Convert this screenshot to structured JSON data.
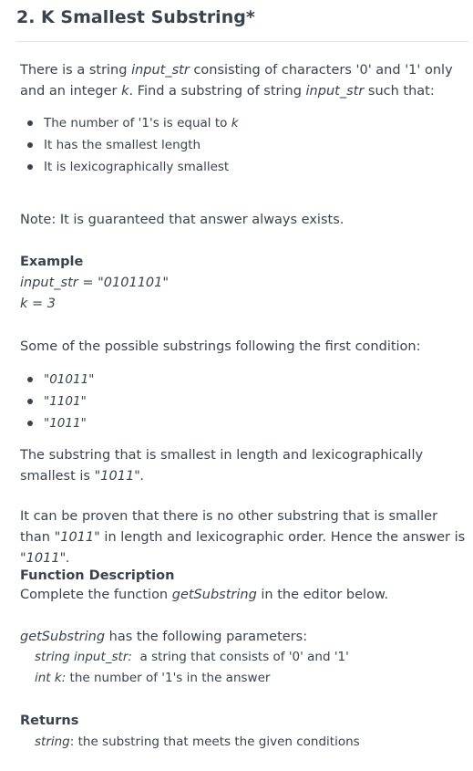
{
  "problem": {
    "title": "2. K Smallest Substring*"
  },
  "intro": {
    "part1": "There is a string ",
    "var_str": "input_str",
    "part2": " consisting of characters '0' and '1' only and an integer ",
    "var_k": "k",
    "part3": ". Find a substring of string ",
    "var_str2": "input_str",
    "part4": " such that:"
  },
  "conditions": [
    {
      "text": "The number of '1's is equal to ",
      "var": "k"
    },
    {
      "text": "It has the smallest length",
      "var": ""
    },
    {
      "text": "It is lexicographically smallest",
      "var": ""
    }
  ],
  "note": "Note: It is guaranteed that answer always exists.",
  "example": {
    "heading": "Example",
    "line1": "input_str = \"0101101\"",
    "line2": "k = 3"
  },
  "possible": {
    "text": "Some of the possible substrings following the first condition:",
    "items": [
      "\"01011\"",
      "\"1101\"",
      "\"1011\""
    ]
  },
  "smallest": {
    "part1": "The substring that is smallest in length and lexicographically smallest is ",
    "answer": "\"1011\"."
  },
  "proof": {
    "part1": "It can be proven that there is no other substring that is smaller than ",
    "answer1": "\"1011\"",
    "part2": " in length and lexicographic order. Hence the answer is ",
    "answer2": "\"1011\"."
  },
  "function_description": {
    "heading": "Function Description",
    "part1": "Complete the function ",
    "fn": "getSubstring",
    "part2": " in the editor below."
  },
  "parameters": {
    "fn": "getSubstring",
    "intro": " has the following parameters:",
    "items": [
      {
        "sig": "string input_str:",
        "desc": "  a string that consists of '0' and '1'"
      },
      {
        "sig": "int k:",
        "desc": " the number of '1's in the answer"
      }
    ]
  },
  "returns": {
    "heading": "Returns",
    "sig": "string",
    "desc": ": the substring that meets the given conditions"
  }
}
